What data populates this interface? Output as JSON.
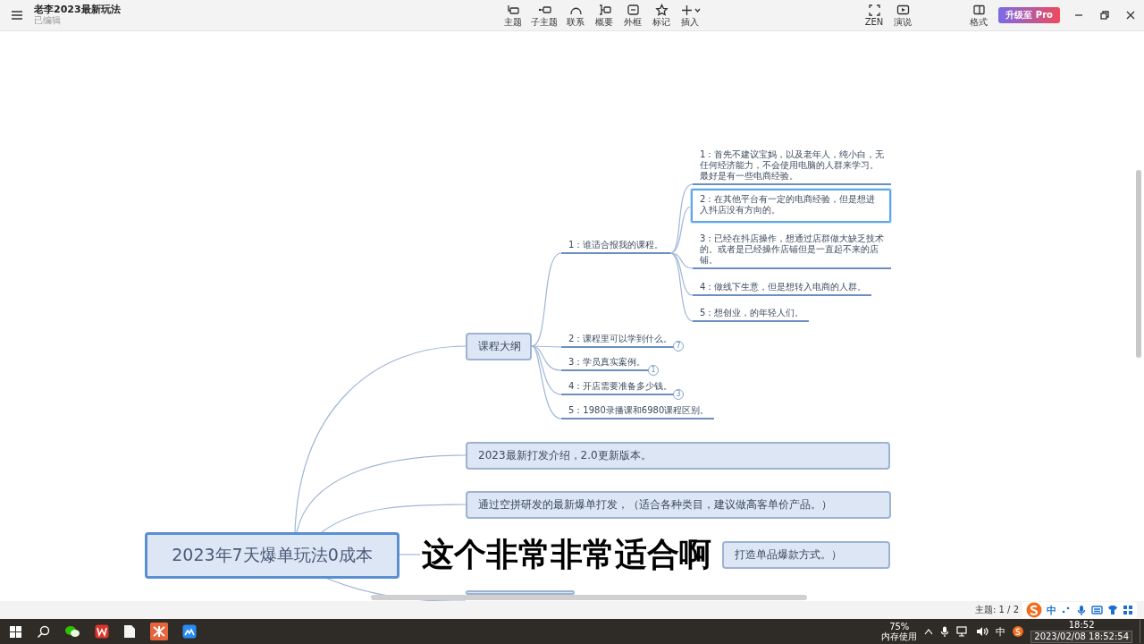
{
  "app": {
    "title": "老李2023最新玩法",
    "status": "已编辑"
  },
  "toolbar": [
    {
      "label": "主题"
    },
    {
      "label": "子主题"
    },
    {
      "label": "联系"
    },
    {
      "label": "概要"
    },
    {
      "label": "外框"
    },
    {
      "label": "标记"
    },
    {
      "label": "插入",
      "dropdown": true
    }
  ],
  "view_tools": [
    {
      "label": "ZEN"
    },
    {
      "label": "演说"
    }
  ],
  "format_button": "格式",
  "upgrade_button": "升级至 Pro",
  "mindmap": {
    "root": {
      "kind": "central",
      "text": "2023年7天爆单玩法0成本",
      "selected": false,
      "children": [
        {
          "kind": "box",
          "text": "课程大纲",
          "selected": false,
          "children": [
            {
              "kind": "line",
              "text": "1：谁适合报我的课程。",
              "selected": false,
              "children": [
                {
                  "kind": "line",
                  "text": "1：首先不建议宝妈，以及老年人，纯小白，无任何经济能力，不会使用电脑的人群来学习。最好是有一些电商经验。",
                  "selected": false
                },
                {
                  "kind": "line",
                  "text": "2：在其他平台有一定的电商经验，但是想进入抖店没有方向的。",
                  "selected": true
                },
                {
                  "kind": "line",
                  "text": "3：已经在抖店操作，想通过店群做大缺乏技术的。或者是已经操作店铺但是一直起不来的店铺。",
                  "selected": false
                },
                {
                  "kind": "line",
                  "text": "4：做线下生意，但是想转入电商的人群。",
                  "selected": false
                },
                {
                  "kind": "line",
                  "text": "5：想创业，的年轻人们。",
                  "selected": false
                }
              ]
            },
            {
              "kind": "line",
              "text": "2：课程里可以学到什么。",
              "selected": false,
              "count": "7"
            },
            {
              "kind": "line",
              "text": "3：学员真实案例。",
              "selected": false,
              "count": "1"
            },
            {
              "kind": "line",
              "text": "4：开店需要准备多少钱。",
              "selected": false,
              "count": "3"
            },
            {
              "kind": "line",
              "text": "5：1980录播课和6980课程区别。",
              "selected": false
            }
          ]
        },
        {
          "kind": "box",
          "text": "2023最新打发介绍，2.0更新版本。",
          "selected": false
        },
        {
          "kind": "box",
          "text": "通过空拼研发的最新爆单打发，（适合各种类目，建议做高客单价产品。）",
          "selected": false
        },
        {
          "kind": "box",
          "text": "打造单品爆款方式。）",
          "selected": false
        },
        {
          "kind": "box",
          "selected": false
        }
      ]
    }
  },
  "subtitle_caption": "这个非常非常适合啊",
  "status_bar": {
    "topic_count": "主题: 1 / 2"
  },
  "ime_toolbar": {
    "mode": "中"
  },
  "taskbar": {
    "memory_percent": "75%",
    "memory_label": "内存使用",
    "input_mode": "中",
    "time": "18:52",
    "datetime_tooltip": "2023/02/08 18:52:54"
  }
}
